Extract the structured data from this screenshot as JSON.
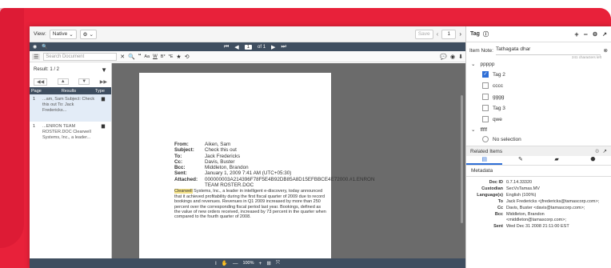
{
  "toolbar": {
    "view_label": "View:",
    "view_value": "Native",
    "view_chev": "⌄",
    "settings": "⚙",
    "settings_chev": "⌄",
    "save": "Save",
    "page_input": "1"
  },
  "nav": {
    "icons": [
      "◉",
      "🔍"
    ],
    "page_text": "1",
    "of_text": "of 1"
  },
  "search": {
    "placeholder": "Search Document"
  },
  "doc_tools": [
    "Aa",
    "W",
    "B*",
    "*E",
    "★",
    "⟲"
  ],
  "result": {
    "label": "Result: 1 / 2",
    "cols": [
      "Page",
      "Results",
      "Type"
    ],
    "rows": [
      {
        "page": "1",
        "text": "...am, Sam Subject: Check this out To: Jack Fredericks..."
      },
      {
        "page": "1",
        "text": "...ENRON TEAM ROSTER.DOC Clearwell Systems, Inc., a leader..."
      }
    ]
  },
  "email": {
    "fields": [
      {
        "k": "From:",
        "v": "Aiken, Sam"
      },
      {
        "k": "Subject:",
        "v": "Check this out"
      },
      {
        "k": "To:",
        "v": "Jack Fredericks"
      },
      {
        "k": "Cc:",
        "v": "Davis, Buster"
      },
      {
        "k": "Bcc:",
        "v": "Middleton, Brandon"
      },
      {
        "k": "Sent:",
        "v": "January 1, 2009 7:41 AM (UTC+05:30)"
      },
      {
        "k": "Attached:",
        "v": "000000003A214396F78F5E4B92DB85A8D15EFBBCE4E72000.#1.ENRON TEAM ROSTER.DOC"
      }
    ],
    "body_hl": "Clearwell",
    "body": " Systems, Inc., a leader in intelligent e-discovery, today announced that it achieved profitability during the first fiscal quarter of 2009 due to record bookings and revenues. Revenues in Q1 2009 increased by more than 250 percent over the corresponding fiscal period last year. Bookings, defined as the value of new orders received, increased by 73 percent in the quarter when compared to the fourth quarter of 2008."
  },
  "zoom": {
    "value": "100%"
  },
  "tag_panel": {
    "title": "Tag",
    "note_label": "Item Note:",
    "note_value": "Tathagata dhar",
    "chars_left": "241 characters left",
    "group1": "ppppp",
    "tags": [
      {
        "label": "Tag 2",
        "checked": true
      },
      {
        "label": "cccc",
        "checked": false
      },
      {
        "label": "gggg",
        "checked": false
      },
      {
        "label": "Tag 3",
        "checked": false
      },
      {
        "label": "qwe",
        "checked": false
      }
    ],
    "group2": "fffff",
    "no_selection": "No selection"
  },
  "related": {
    "title": "Related Items",
    "metadata_label": "Metadata"
  },
  "metadata": [
    {
      "k": "Doc ID",
      "v": "0.7.14.33320"
    },
    {
      "k": "Custodian",
      "v": "SecVsTamas.MV"
    },
    {
      "k": "Language(s)",
      "v": "English (100%)"
    },
    {
      "k": "To",
      "v": "Jack Fredericks <jfredericks@tamascorp.com>;"
    },
    {
      "k": "Cc",
      "v": "Davis, Buster <davis@tamascorp.com>;"
    },
    {
      "k": "Bcc",
      "v": "Middleton, Brandon <middleton@tamascorp.com>;"
    },
    {
      "k": "Sent",
      "v": "Wed Dec 31 2008 21:11:00 EST"
    }
  ]
}
